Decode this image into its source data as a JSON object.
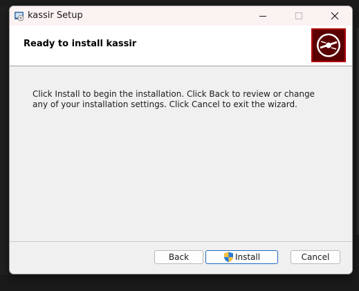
{
  "window": {
    "title": "kassir Setup"
  },
  "titlebar": {
    "icons": [
      "installer-app-icon",
      "minimize-icon",
      "maximize-icon",
      "close-icon"
    ]
  },
  "header": {
    "title": "Ready to install kassir",
    "logo": "disc-logo"
  },
  "body": {
    "text": "Click Install to begin the installation. Click Back to review or change any of your installation settings. Click Cancel to exit the wizard."
  },
  "buttons": {
    "back": "Back",
    "install": "Install",
    "cancel": "Cancel"
  },
  "colors": {
    "titlebar_bg": "#fbf2f2",
    "logo_red": "#b00000",
    "install_border": "#1f69c0"
  }
}
